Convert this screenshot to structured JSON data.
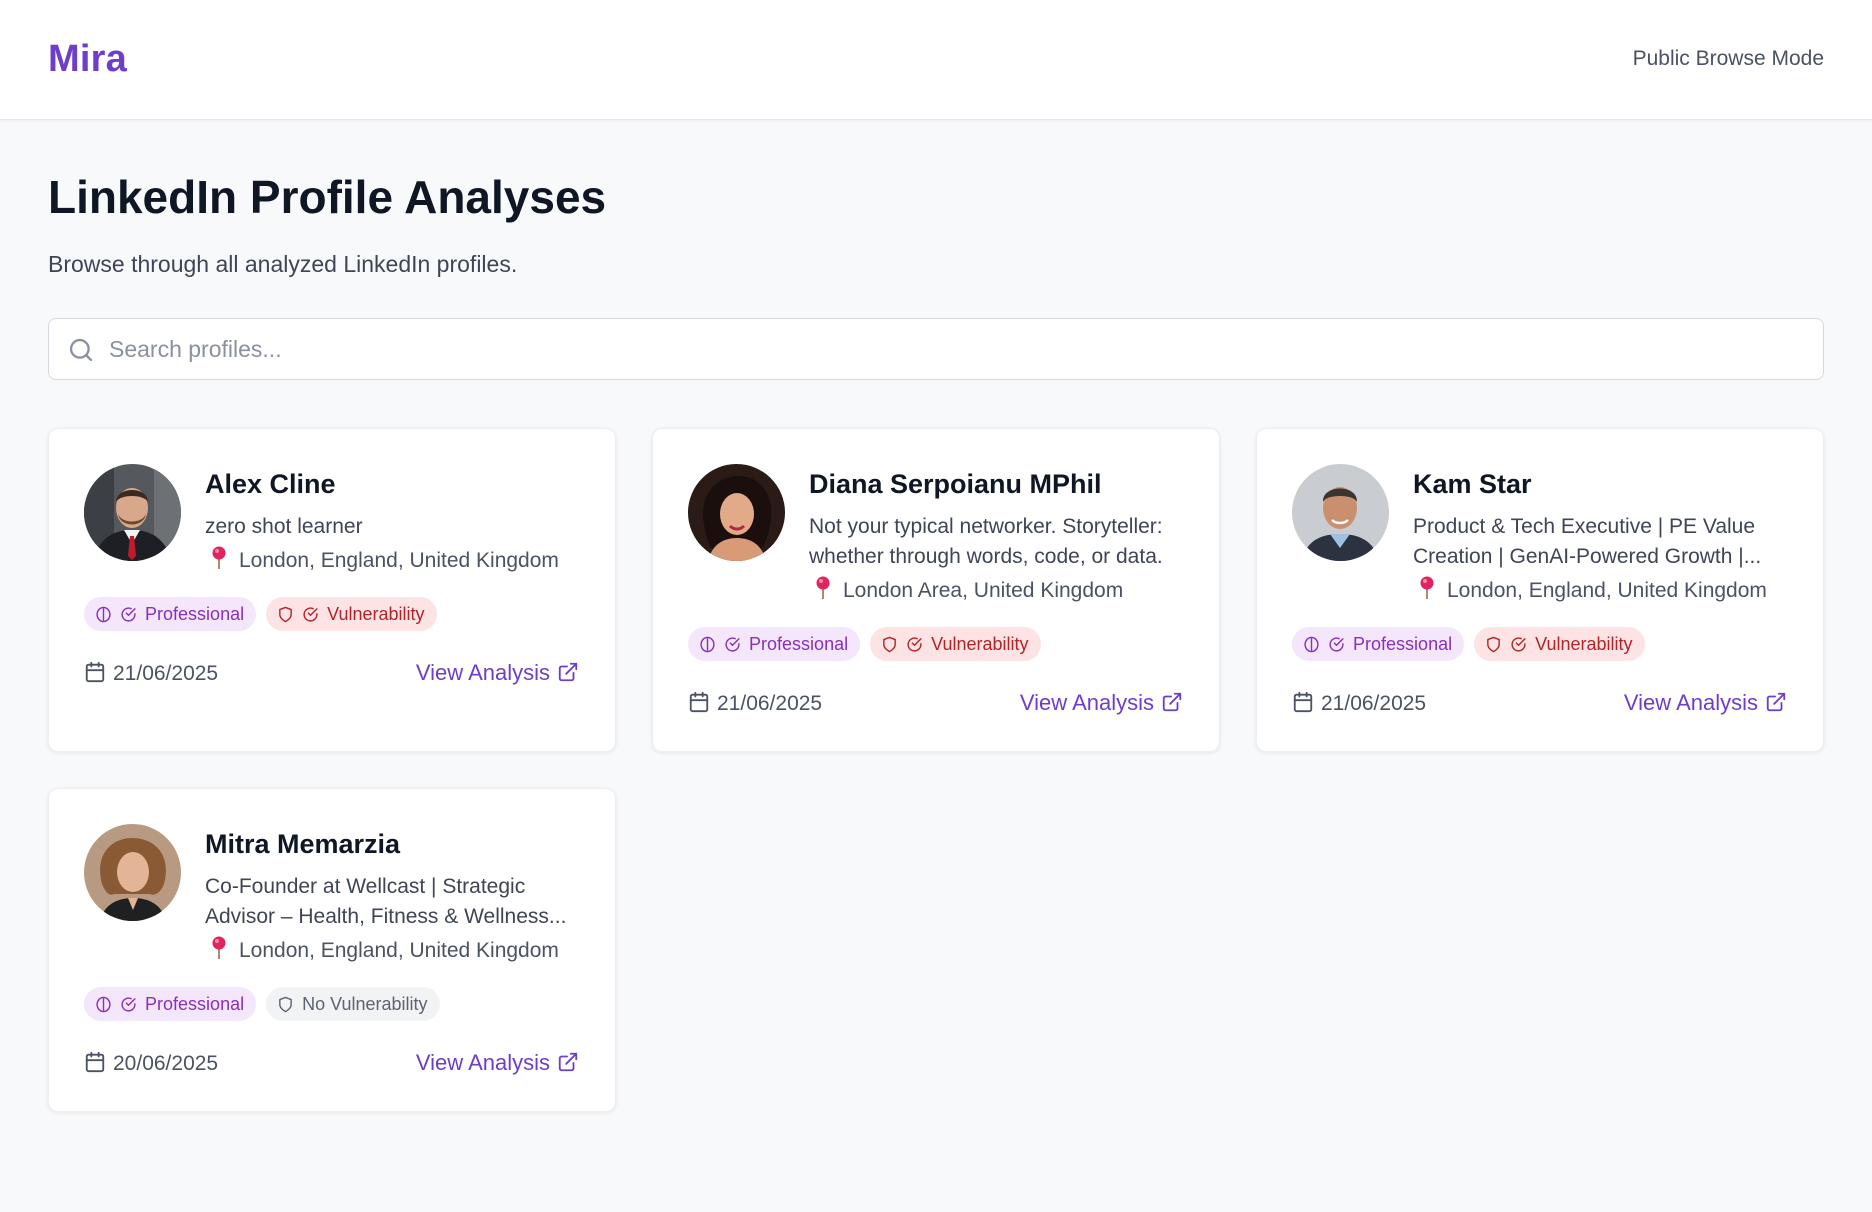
{
  "header": {
    "brand": "Mira",
    "mode_label": "Public Browse Mode"
  },
  "page": {
    "title": "LinkedIn Profile Analyses",
    "subtitle": "Browse through all analyzed LinkedIn profiles."
  },
  "search": {
    "placeholder": "Search profiles...",
    "value": ""
  },
  "colors": {
    "brand": "#6d3ec9",
    "professional_badge_bg": "#f4e6fb",
    "professional_badge_text": "#8a2fb7",
    "vulnerability_badge_bg": "#fde3e3",
    "vulnerability_badge_text": "#b0242a",
    "no_vulnerability_badge_bg": "#f2f3f5",
    "pin": "#e0245e"
  },
  "profiles": [
    {
      "name": "Alex Cline",
      "headline": "zero shot learner",
      "location": "London, England, United Kingdom",
      "badges": [
        {
          "label": "Professional",
          "type": "professional",
          "icons": [
            "brain-icon",
            "check-circle-icon"
          ]
        },
        {
          "label": "Vulnerability",
          "type": "vulnerability",
          "icons": [
            "shield-icon",
            "check-circle-icon"
          ]
        }
      ],
      "date": "21/06/2025",
      "action_label": "View Analysis"
    },
    {
      "name": "Diana Serpoianu MPhil",
      "headline": "Not your typical networker. Storyteller: whether through words, code, or data.",
      "location": "London Area, United Kingdom",
      "badges": [
        {
          "label": "Professional",
          "type": "professional",
          "icons": [
            "brain-icon",
            "check-circle-icon"
          ]
        },
        {
          "label": "Vulnerability",
          "type": "vulnerability",
          "icons": [
            "shield-icon",
            "check-circle-icon"
          ]
        }
      ],
      "date": "21/06/2025",
      "action_label": "View Analysis"
    },
    {
      "name": "Kam Star",
      "headline": "Product & Tech Executive | PE Value Creation | GenAI-Powered Growth |...",
      "location": "London, England, United Kingdom",
      "badges": [
        {
          "label": "Professional",
          "type": "professional",
          "icons": [
            "brain-icon",
            "check-circle-icon"
          ]
        },
        {
          "label": "Vulnerability",
          "type": "vulnerability",
          "icons": [
            "shield-icon",
            "check-circle-icon"
          ]
        }
      ],
      "date": "21/06/2025",
      "action_label": "View Analysis"
    },
    {
      "name": "Mitra Memarzia",
      "headline": "Co-Founder at Wellcast | Strategic Advisor – Health, Fitness & Wellness...",
      "location": "London, England, United Kingdom",
      "badges": [
        {
          "label": "Professional",
          "type": "professional",
          "icons": [
            "brain-icon",
            "check-circle-icon"
          ]
        },
        {
          "label": "No Vulnerability",
          "type": "no-vulnerability",
          "icons": [
            "shield-icon"
          ]
        }
      ],
      "date": "20/06/2025",
      "action_label": "View Analysis"
    }
  ]
}
